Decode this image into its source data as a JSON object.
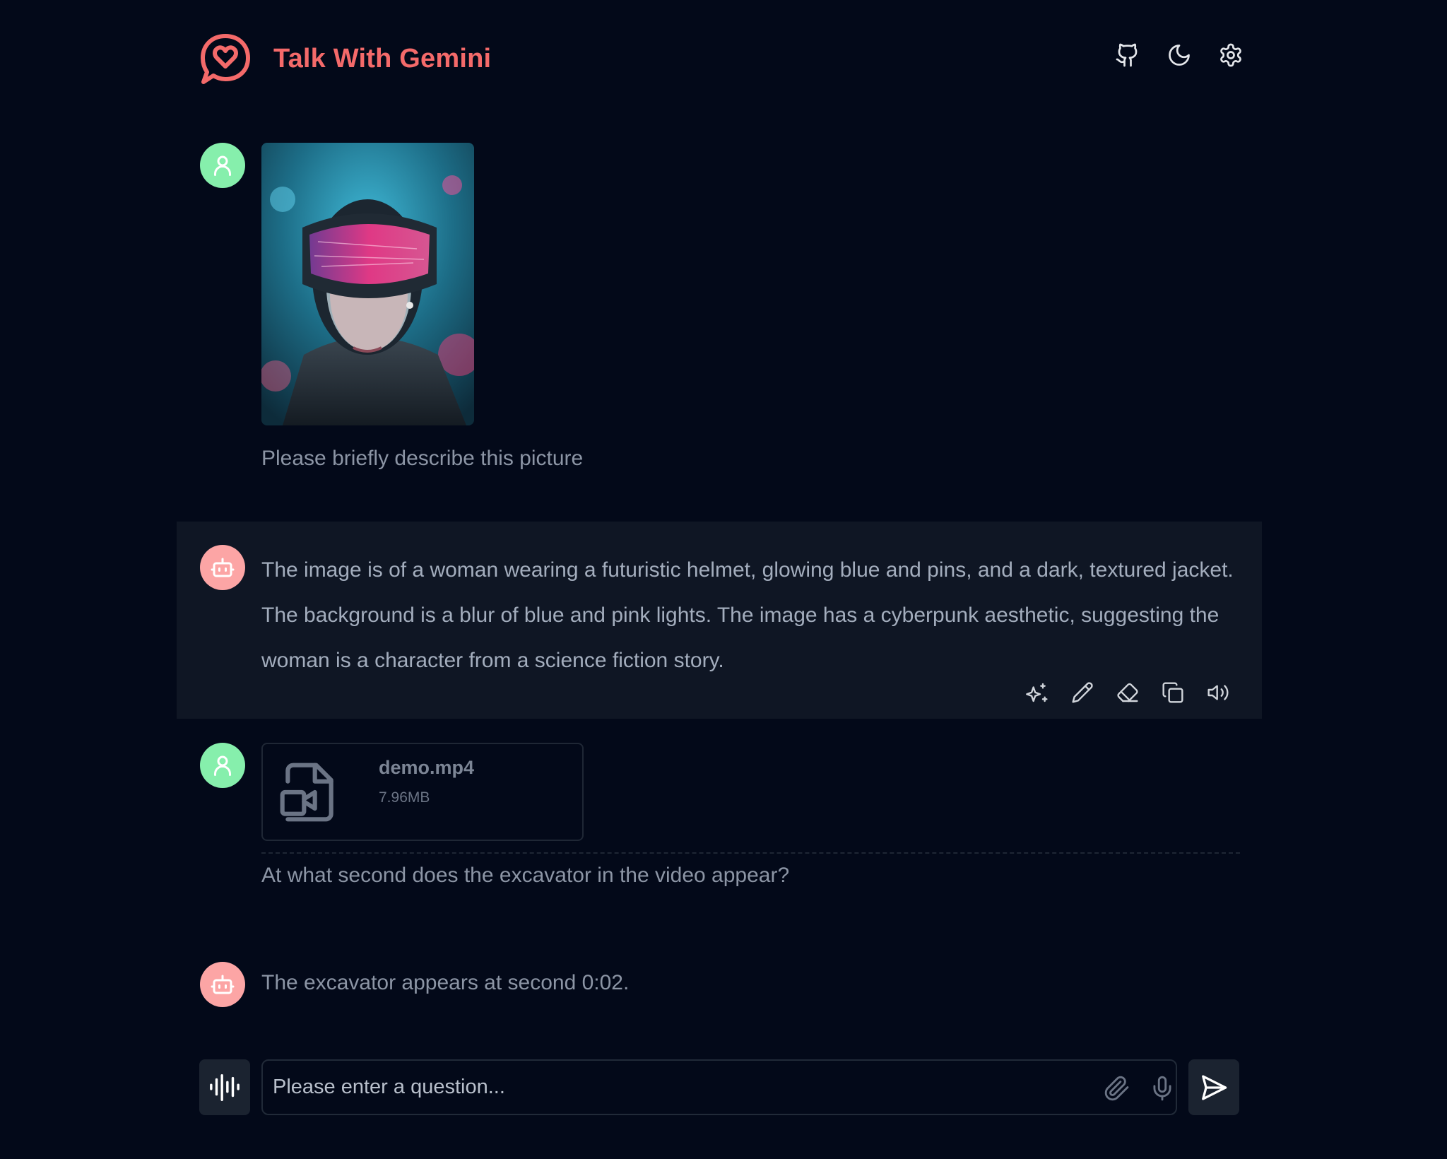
{
  "app": {
    "title": "Talk With Gemini",
    "brand_color": "#f46a6a"
  },
  "header": {
    "actions": [
      {
        "icon": "github-icon"
      },
      {
        "icon": "moon-icon"
      },
      {
        "icon": "settings-icon"
      }
    ]
  },
  "messages": [
    {
      "role": "user",
      "avatar_color": "#86efac",
      "attachment": {
        "type": "image",
        "description_icon": "image-attachment"
      },
      "text": "Please briefly describe this picture"
    },
    {
      "role": "model",
      "avatar_color": "#fca5a5",
      "text": "The image is of a woman wearing a futuristic helmet, glowing blue and pins, and a dark, textured jacket. The background is a blur of blue and pink lights. The image has a cyberpunk aesthetic, suggesting the woman is a character from a science fiction story.",
      "actions": [
        "sparkles-icon",
        "pencil-icon",
        "eraser-icon",
        "copy-icon",
        "speaker-icon"
      ]
    },
    {
      "role": "user",
      "avatar_color": "#86efac",
      "attachment": {
        "type": "file",
        "name": "demo.mp4",
        "size": "7.96MB",
        "icon": "file-video-icon"
      },
      "text": "At what second does the excavator in the video appear?"
    },
    {
      "role": "model",
      "avatar_color": "#fca5a5",
      "text": "The excavator appears at second 0:02."
    }
  ],
  "input": {
    "placeholder": "Please enter a question...",
    "value": "",
    "icons": [
      "paperclip-icon",
      "mic-icon"
    ]
  },
  "controls": {
    "voice_icon": "audio-waveform-icon",
    "send_icon": "send-icon"
  }
}
